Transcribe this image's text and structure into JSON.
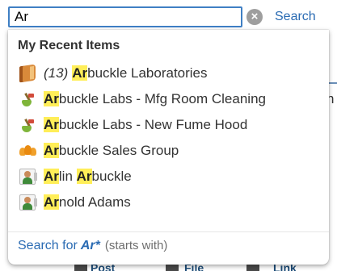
{
  "search": {
    "value": "Ar",
    "button_label": "Search",
    "clear_symbol": "×"
  },
  "dropdown": {
    "heading": "My Recent Items",
    "items": [
      {
        "icon": "book-icon",
        "prefix": "(13)",
        "highlight": "Ar",
        "rest": "buckle Laboratories"
      },
      {
        "icon": "broom-icon",
        "prefix": "",
        "highlight": "Ar",
        "rest": "buckle Labs - Mfg Room Cleaning"
      },
      {
        "icon": "broom-icon",
        "prefix": "",
        "highlight": "Ar",
        "rest": "buckle Labs - New Fume Hood"
      },
      {
        "icon": "group-icon",
        "prefix": "",
        "highlight": "Ar",
        "rest": "buckle Sales Group"
      },
      {
        "icon": "contact-icon",
        "prefix": "",
        "highlight": "Ar",
        "rest": "lin ",
        "highlight2": "Ar",
        "rest2": "buckle"
      },
      {
        "icon": "contact-icon",
        "prefix": "",
        "highlight": "Ar",
        "rest": "nold Adams"
      }
    ],
    "search_for": {
      "label": "Search for",
      "term": "Ar*",
      "note": "(starts with)"
    }
  },
  "background": {
    "right_fragment": "n",
    "bottom_items": [
      "Post",
      "File",
      "Link"
    ]
  },
  "colors": {
    "accent": "#2a6bb3",
    "input_border": "#3f7fc4",
    "highlight": "#ffee58"
  }
}
